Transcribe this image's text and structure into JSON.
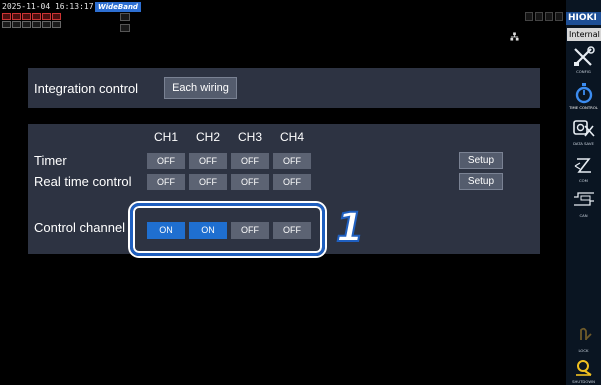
{
  "status_bar": {
    "datetime": "2025-11-04 16:13:17",
    "mode_badge": "WideBand"
  },
  "sidebar": {
    "brand": "HIOKI",
    "mode_label": "Internal",
    "items": [
      {
        "label": "CONFIG",
        "icon": "wrench-screwdriver-icon"
      },
      {
        "label": "TIME CONTROL",
        "icon": "stopwatch-icon",
        "active": true
      },
      {
        "label": "DATA SAVE",
        "icon": "data-save-icon"
      },
      {
        "label": "COM",
        "icon": "com-icon"
      },
      {
        "label": "CAN",
        "icon": "can-icon"
      },
      {
        "label": "LOCK",
        "icon": "lock-icon"
      },
      {
        "label": "SHUTDOWN",
        "icon": "shutdown-icon"
      }
    ]
  },
  "integration": {
    "label": "Integration control",
    "value": "Each wiring"
  },
  "channels": {
    "headers": [
      "CH1",
      "CH2",
      "CH3",
      "CH4"
    ],
    "timer": {
      "label": "Timer",
      "values": [
        "OFF",
        "OFF",
        "OFF",
        "OFF"
      ],
      "setup": "Setup"
    },
    "real_time": {
      "label": "Real time control",
      "values": [
        "OFF",
        "OFF",
        "OFF",
        "OFF"
      ],
      "setup": "Setup"
    },
    "control_channel": {
      "label": "Control channel",
      "values": [
        "ON",
        "ON",
        "OFF",
        "OFF"
      ]
    }
  },
  "annotation": {
    "step_number": "1"
  },
  "colors": {
    "panel": "#2d3342",
    "on_button": "#1f6fd0",
    "off_button": "#5c6373",
    "highlight": "#1f5fbf"
  }
}
